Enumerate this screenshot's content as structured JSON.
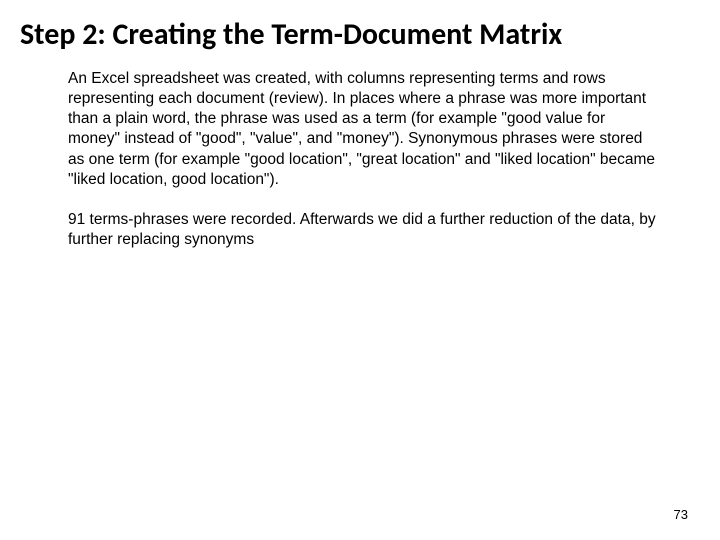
{
  "slide": {
    "title": "Step 2: Creating the Term-Document Matrix",
    "paragraph1": "An Excel spreadsheet was created, with columns representing terms and rows representing each document (review). In places where a phrase was more important than a plain word, the phrase was used as a term (for example \"good value for money\" instead of \"good\", \"value\", and \"money\"). Synonymous phrases were stored as one term (for example \"good location\", \"great location\" and \"liked location\" became \"liked location, good location\").",
    "paragraph2": "91 terms-phrases were recorded. Afterwards we did a further reduction of the data, by further replacing synonyms",
    "page_number": "73"
  }
}
